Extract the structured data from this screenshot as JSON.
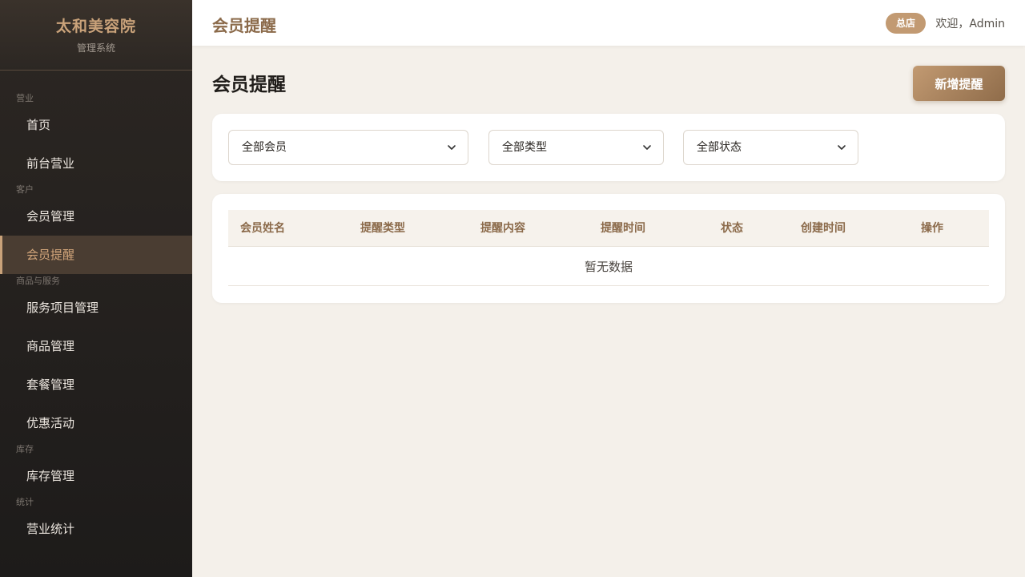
{
  "brand": {
    "name": "太和美容院",
    "subtitle": "管理系统"
  },
  "sidebar": {
    "groups": [
      {
        "label": "营业",
        "items": [
          "首页",
          "前台营业"
        ]
      },
      {
        "label": "客户",
        "items": [
          "会员管理",
          "会员提醒"
        ]
      },
      {
        "label": "商品与服务",
        "items": [
          "服务项目管理",
          "商品管理",
          "套餐管理",
          "优惠活动"
        ]
      },
      {
        "label": "库存",
        "items": [
          "库存管理"
        ]
      },
      {
        "label": "统计",
        "items": [
          "营业统计"
        ]
      }
    ],
    "active_item": "会员提醒"
  },
  "topbar": {
    "title": "会员提醒",
    "store_badge": "总店",
    "welcome": "欢迎，Admin"
  },
  "main": {
    "page_title": "会员提醒",
    "add_button": "新增提醒",
    "filters": {
      "member": "全部会员",
      "type": "全部类型",
      "status": "全部状态"
    },
    "table": {
      "columns": [
        "会员姓名",
        "提醒类型",
        "提醒内容",
        "提醒时间",
        "状态",
        "创建时间",
        "操作"
      ],
      "rows": [],
      "empty_text": "暂无数据"
    }
  },
  "colors": {
    "accent": "#c9a27a",
    "accent_dark": "#8b6a4a",
    "sidebar_bg": "#1d1b1a",
    "page_bg": "#f4f0ea"
  }
}
